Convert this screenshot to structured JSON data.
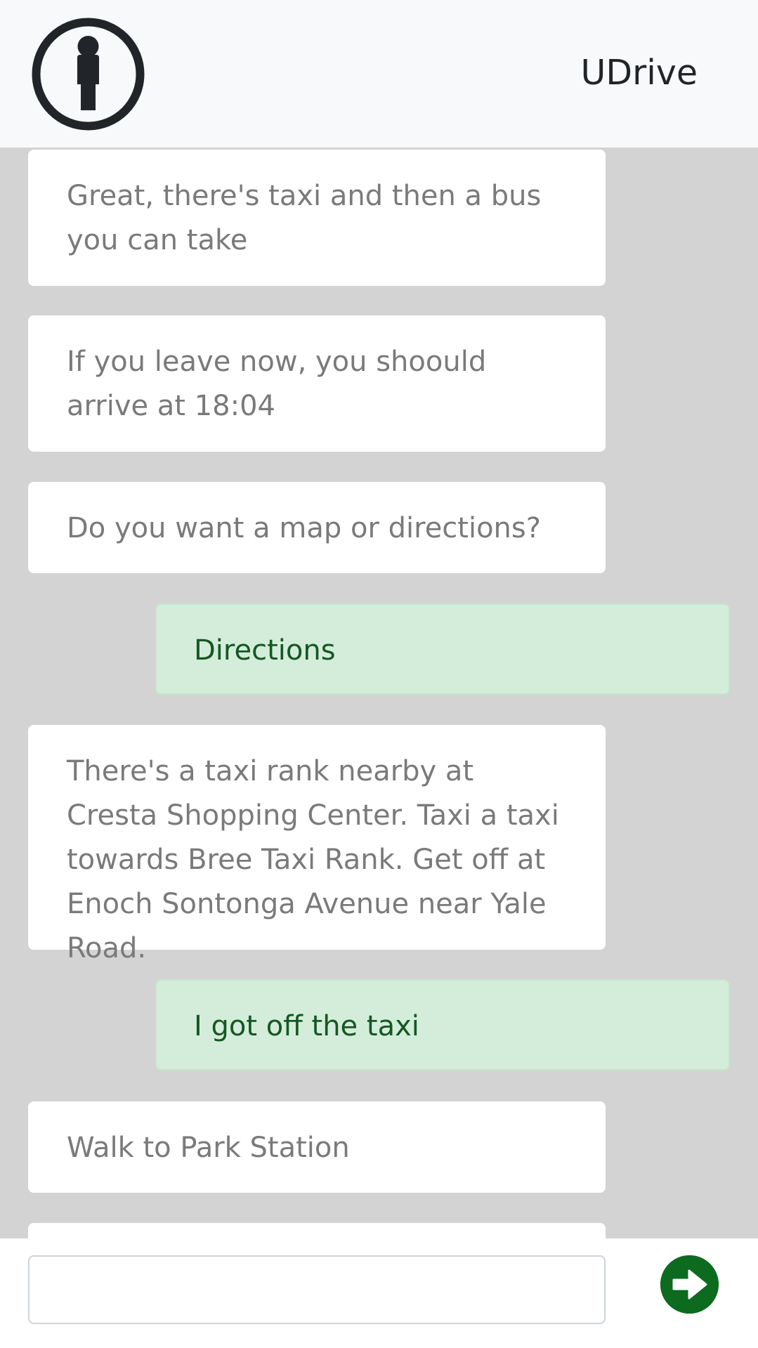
{
  "header": {
    "brand": "UDrive",
    "logo_icon": "info-person-icon"
  },
  "messages": [
    {
      "sender": "bot",
      "text": "Great, there's taxi and then a bus you can take"
    },
    {
      "sender": "bot",
      "text": "If you leave now, you shoould arrive at 18:04"
    },
    {
      "sender": "bot",
      "text": "Do you want a map or directions?"
    },
    {
      "sender": "user",
      "text": "Directions"
    },
    {
      "sender": "bot",
      "text": "There's a taxi rank nearby at Cresta Shopping Center. Taxi a taxi towards Bree Taxi Rank. Get off at Enoch Sontonga Avenue near Yale Road."
    },
    {
      "sender": "user",
      "text": "I got off the taxi"
    },
    {
      "sender": "bot",
      "text": "Walk to Park Station"
    },
    {
      "sender": "bot",
      "text": ""
    }
  ],
  "composer": {
    "value": "",
    "placeholder": "",
    "send_icon": "arrow-right-circle-icon"
  },
  "colors": {
    "chat_background": "#d3d3d3",
    "bot_bubble": "#ffffff",
    "user_bubble": "#d4edda",
    "user_text": "#155724",
    "send_button": "#0c6b1f"
  }
}
